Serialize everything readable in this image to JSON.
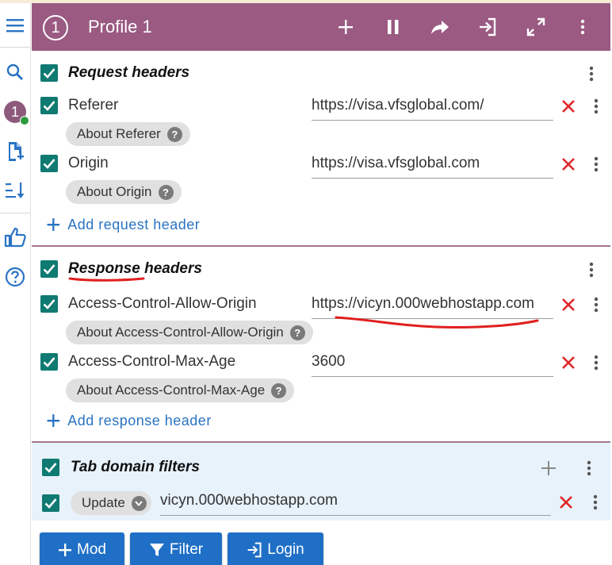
{
  "nav": {
    "items": [
      {
        "icon": "menu-icon"
      },
      {
        "icon": "search-icon"
      },
      {
        "icon": "profile-badge",
        "label": "1"
      },
      {
        "icon": "add-file-icon"
      },
      {
        "icon": "sort-icon"
      },
      {
        "icon": "thumbs-up-icon"
      },
      {
        "icon": "help-icon"
      }
    ]
  },
  "header": {
    "number": "1",
    "title": "Profile 1",
    "color": "#9a5a82",
    "icons": [
      "plus-icon",
      "pause-icon",
      "share-icon",
      "login-icon",
      "fullscreen-icon",
      "more-vert-icon"
    ]
  },
  "request": {
    "title": "Request headers",
    "rows": [
      {
        "name": "Referer",
        "value": "https://visa.vfsglobal.com/",
        "about": "About Referer"
      },
      {
        "name": "Origin",
        "value": "https://visa.vfsglobal.com",
        "about": "About Origin"
      }
    ],
    "add_label": "Add request header"
  },
  "response": {
    "title": "Response headers",
    "rows": [
      {
        "name": "Access-Control-Allow-Origin",
        "value": "https://vicyn.000webhostapp.com",
        "about": "About Access-Control-Allow-Origin"
      },
      {
        "name": "Access-Control-Max-Age",
        "value": "3600",
        "about": "About Access-Control-Max-Age"
      }
    ],
    "add_label": "Add response header"
  },
  "filters": {
    "title": "Tab domain filters",
    "mode": "Update",
    "value": "vicyn.000webhostapp.com"
  },
  "buttons": {
    "mod": "Mod",
    "filter": "Filter",
    "login": "Login"
  },
  "colors": {
    "accent": "#9a5a82",
    "checkbox": "#0f7a72",
    "delete": "#e0262a",
    "link": "#2a73c4",
    "annotation": "#e02020"
  }
}
